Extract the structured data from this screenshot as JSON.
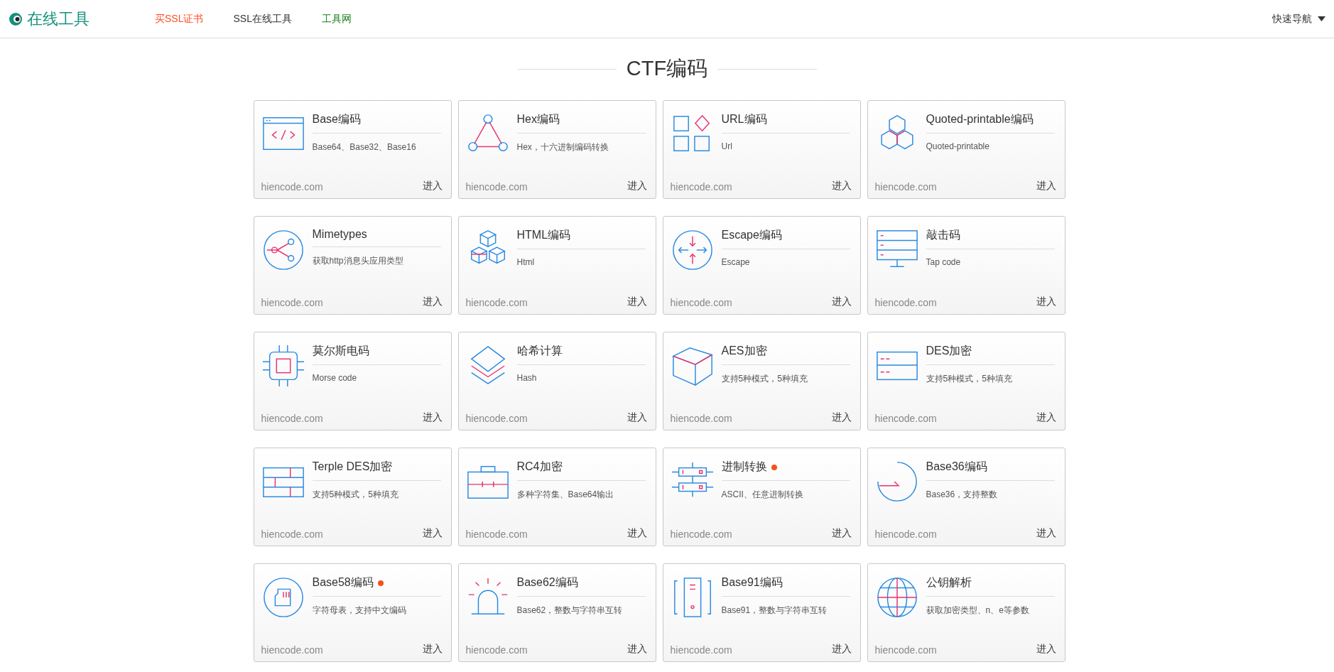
{
  "header": {
    "logo_text": "在线工具",
    "nav": [
      {
        "label": "买SSL证书",
        "color": "#ff4c1f"
      },
      {
        "label": "SSL在线工具",
        "color": "#333333"
      },
      {
        "label": "工具网",
        "color": "#1a7f1a"
      }
    ],
    "quick_nav": "快速导航"
  },
  "section_title": "CTF编码",
  "cards": [
    {
      "title": "Base编码",
      "new": false,
      "desc": "Base64、Base32、Base16",
      "site": "hiencode.com",
      "link": "进入"
    },
    {
      "title": "Hex编码",
      "new": false,
      "desc": "Hex，十六进制编码转换",
      "site": "hiencode.com",
      "link": "进入"
    },
    {
      "title": "URL编码",
      "new": false,
      "desc": "Url",
      "site": "hiencode.com",
      "link": "进入"
    },
    {
      "title": "Quoted-printable编码",
      "new": false,
      "desc": "Quoted-printable",
      "site": "hiencode.com",
      "link": "进入"
    },
    {
      "title": "Mimetypes",
      "new": false,
      "desc": "获取http消息头应用类型",
      "site": "hiencode.com",
      "link": "进入"
    },
    {
      "title": "HTML编码",
      "new": false,
      "desc": "Html",
      "site": "hiencode.com",
      "link": "进入"
    },
    {
      "title": "Escape编码",
      "new": false,
      "desc": "Escape",
      "site": "hiencode.com",
      "link": "进入"
    },
    {
      "title": "敲击码",
      "new": false,
      "desc": "Tap code",
      "site": "hiencode.com",
      "link": "进入"
    },
    {
      "title": "莫尔斯电码",
      "new": false,
      "desc": "Morse code",
      "site": "hiencode.com",
      "link": "进入"
    },
    {
      "title": "哈希计算",
      "new": false,
      "desc": "Hash",
      "site": "hiencode.com",
      "link": "进入"
    },
    {
      "title": "AES加密",
      "new": false,
      "desc": "支持5种模式，5种填充",
      "site": "hiencode.com",
      "link": "进入"
    },
    {
      "title": "DES加密",
      "new": false,
      "desc": "支持5种模式，5种填充",
      "site": "hiencode.com",
      "link": "进入"
    },
    {
      "title": "Terple DES加密",
      "new": false,
      "desc": "支持5种模式，5种填充",
      "site": "hiencode.com",
      "link": "进入"
    },
    {
      "title": "RC4加密",
      "new": false,
      "desc": "多种字符集、Base64输出",
      "site": "hiencode.com",
      "link": "进入"
    },
    {
      "title": "进制转换",
      "new": true,
      "desc": "ASCII、任意进制转换",
      "site": "hiencode.com",
      "link": "进入"
    },
    {
      "title": "Base36编码",
      "new": false,
      "desc": "Base36，支持整数",
      "site": "hiencode.com",
      "link": "进入"
    },
    {
      "title": "Base58编码",
      "new": true,
      "desc": "字符母表，支持中文编码",
      "site": "hiencode.com",
      "link": "进入"
    },
    {
      "title": "Base62编码",
      "new": false,
      "desc": "Base62，整数与字符串互转",
      "site": "hiencode.com",
      "link": "进入"
    },
    {
      "title": "Base91编码",
      "new": false,
      "desc": "Base91，整数与字符串互转",
      "site": "hiencode.com",
      "link": "进入"
    },
    {
      "title": "公钥解析",
      "new": false,
      "desc": "获取加密类型、n、e等参数",
      "site": "hiencode.com",
      "link": "进入"
    }
  ]
}
